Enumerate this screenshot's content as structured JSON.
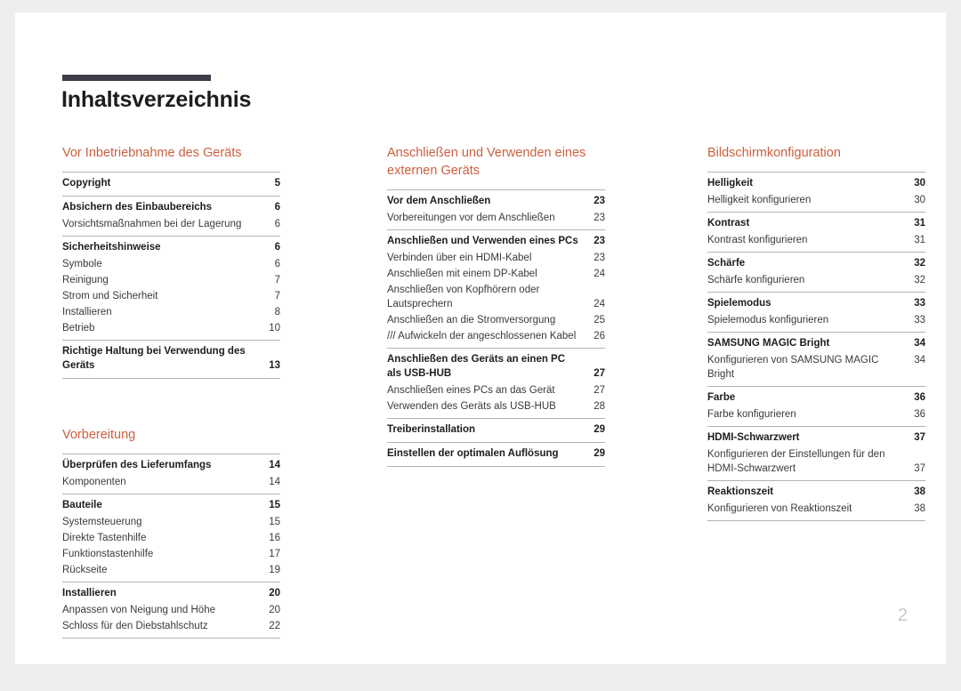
{
  "document": {
    "title": "Inhaltsverzeichnis",
    "page_number": "2",
    "accent_color": "#cb5f3f",
    "rule_color": "#3d3c49",
    "separator_color": "#b3b2b2"
  },
  "columns": [
    {
      "sections": [
        {
          "heading": "Vor Inbetriebnahme des Geräts",
          "groups": [
            {
              "entries": [
                {
                  "level": 1,
                  "label": "Copyright",
                  "page": "5"
                }
              ]
            },
            {
              "entries": [
                {
                  "level": 1,
                  "label": "Absichern des Einbaubereichs",
                  "page": "6"
                },
                {
                  "level": 2,
                  "label": "Vorsichtsmaßnahmen bei der Lagerung",
                  "page": "6"
                }
              ]
            },
            {
              "entries": [
                {
                  "level": 1,
                  "label": "Sicherheitshinweise",
                  "page": "6"
                },
                {
                  "level": 2,
                  "label": "Symbole",
                  "page": "6"
                },
                {
                  "level": 2,
                  "label": "Reinigung",
                  "page": "7"
                },
                {
                  "level": 2,
                  "label": "Strom und Sicherheit",
                  "page": "7"
                },
                {
                  "level": 2,
                  "label": "Installieren",
                  "page": "8"
                },
                {
                  "level": 2,
                  "label": "Betrieb",
                  "page": "10"
                }
              ]
            },
            {
              "entries": [
                {
                  "level": 1,
                  "label": "Richtige Haltung bei Verwendung des Geräts",
                  "page": "13",
                  "wrap": true
                }
              ]
            }
          ]
        },
        {
          "heading": "Vorbereitung",
          "spacer_before": true,
          "groups": [
            {
              "entries": [
                {
                  "level": 1,
                  "label": "Überprüfen des Lieferumfangs",
                  "page": "14"
                },
                {
                  "level": 2,
                  "label": "Komponenten",
                  "page": "14"
                }
              ]
            },
            {
              "entries": [
                {
                  "level": 1,
                  "label": "Bauteile",
                  "page": "15"
                },
                {
                  "level": 2,
                  "label": "Systemsteuerung",
                  "page": "15"
                },
                {
                  "level": 2,
                  "label": "Direkte Tastenhilfe",
                  "page": "16"
                },
                {
                  "level": 2,
                  "label": "Funktionstastenhilfe",
                  "page": "17"
                },
                {
                  "level": 2,
                  "label": "Rückseite",
                  "page": "19"
                }
              ]
            },
            {
              "entries": [
                {
                  "level": 1,
                  "label": "Installieren",
                  "page": "20"
                },
                {
                  "level": 2,
                  "label": "Anpassen von Neigung und Höhe",
                  "page": "20"
                },
                {
                  "level": 2,
                  "label": "Schloss für den Diebstahlschutz",
                  "page": "22"
                }
              ]
            }
          ]
        }
      ]
    },
    {
      "sections": [
        {
          "heading": "Anschließen und Verwenden eines externen Geräts",
          "groups": [
            {
              "entries": [
                {
                  "level": 1,
                  "label": "Vor dem Anschließen",
                  "page": "23"
                },
                {
                  "level": 2,
                  "label": "Vorbereitungen vor dem Anschließen",
                  "page": "23"
                }
              ]
            },
            {
              "entries": [
                {
                  "level": 1,
                  "label": "Anschließen und Verwenden eines PCs",
                  "page": "23"
                },
                {
                  "level": 2,
                  "label": "Verbinden über ein HDMI-Kabel",
                  "page": "23"
                },
                {
                  "level": 2,
                  "label": "Anschließen mit einem DP-Kabel",
                  "page": "24"
                },
                {
                  "level": 2,
                  "label": "Anschließen von Kopfhörern oder Lautsprechern",
                  "page": "24",
                  "wrap": true
                },
                {
                  "level": 2,
                  "label": "Anschließen an die Stromversorgung",
                  "page": "25"
                },
                {
                  "level": 2,
                  "label": "/// Aufwickeln der angeschlossenen Kabel",
                  "page": "26"
                }
              ]
            },
            {
              "entries": [
                {
                  "level": 1,
                  "label": "Anschließen des Geräts an einen PC als USB-HUB",
                  "page": "27",
                  "wrap": true
                },
                {
                  "level": 2,
                  "label": "Anschließen eines PCs an das Gerät",
                  "page": "27"
                },
                {
                  "level": 2,
                  "label": "Verwenden des Geräts als USB-HUB",
                  "page": "28"
                }
              ]
            },
            {
              "entries": [
                {
                  "level": 1,
                  "label": "Treiberinstallation",
                  "page": "29"
                }
              ]
            },
            {
              "entries": [
                {
                  "level": 1,
                  "label": "Einstellen der optimalen Auflösung",
                  "page": "29"
                }
              ]
            }
          ]
        }
      ]
    },
    {
      "sections": [
        {
          "heading": "Bildschirmkonfiguration",
          "groups": [
            {
              "entries": [
                {
                  "level": 1,
                  "label": "Helligkeit",
                  "page": "30"
                },
                {
                  "level": 2,
                  "label": "Helligkeit konfigurieren",
                  "page": "30"
                }
              ]
            },
            {
              "entries": [
                {
                  "level": 1,
                  "label": "Kontrast",
                  "page": "31"
                },
                {
                  "level": 2,
                  "label": "Kontrast konfigurieren",
                  "page": "31"
                }
              ]
            },
            {
              "entries": [
                {
                  "level": 1,
                  "label": "Schärfe",
                  "page": "32"
                },
                {
                  "level": 2,
                  "label": "Schärfe konfigurieren",
                  "page": "32"
                }
              ]
            },
            {
              "entries": [
                {
                  "level": 1,
                  "label": "Spielemodus",
                  "page": "33"
                },
                {
                  "level": 2,
                  "label": "Spielemodus konfigurieren",
                  "page": "33"
                }
              ]
            },
            {
              "entries": [
                {
                  "level": 1,
                  "label": "SAMSUNG MAGIC Bright",
                  "page": "34"
                },
                {
                  "level": 2,
                  "label": "Konfigurieren von SAMSUNG MAGIC Bright",
                  "page": "34"
                }
              ]
            },
            {
              "entries": [
                {
                  "level": 1,
                  "label": "Farbe",
                  "page": "36"
                },
                {
                  "level": 2,
                  "label": "Farbe konfigurieren",
                  "page": "36"
                }
              ]
            },
            {
              "entries": [
                {
                  "level": 1,
                  "label": "HDMI-Schwarzwert",
                  "page": "37"
                },
                {
                  "level": 2,
                  "label": "Konfigurieren der Einstellungen für den HDMI-Schwarzwert",
                  "page": "37",
                  "wrap": true
                }
              ]
            },
            {
              "entries": [
                {
                  "level": 1,
                  "label": "Reaktionszeit",
                  "page": "38"
                },
                {
                  "level": 2,
                  "label": "Konfigurieren von Reaktionszeit",
                  "page": "38"
                }
              ]
            }
          ]
        }
      ]
    }
  ]
}
